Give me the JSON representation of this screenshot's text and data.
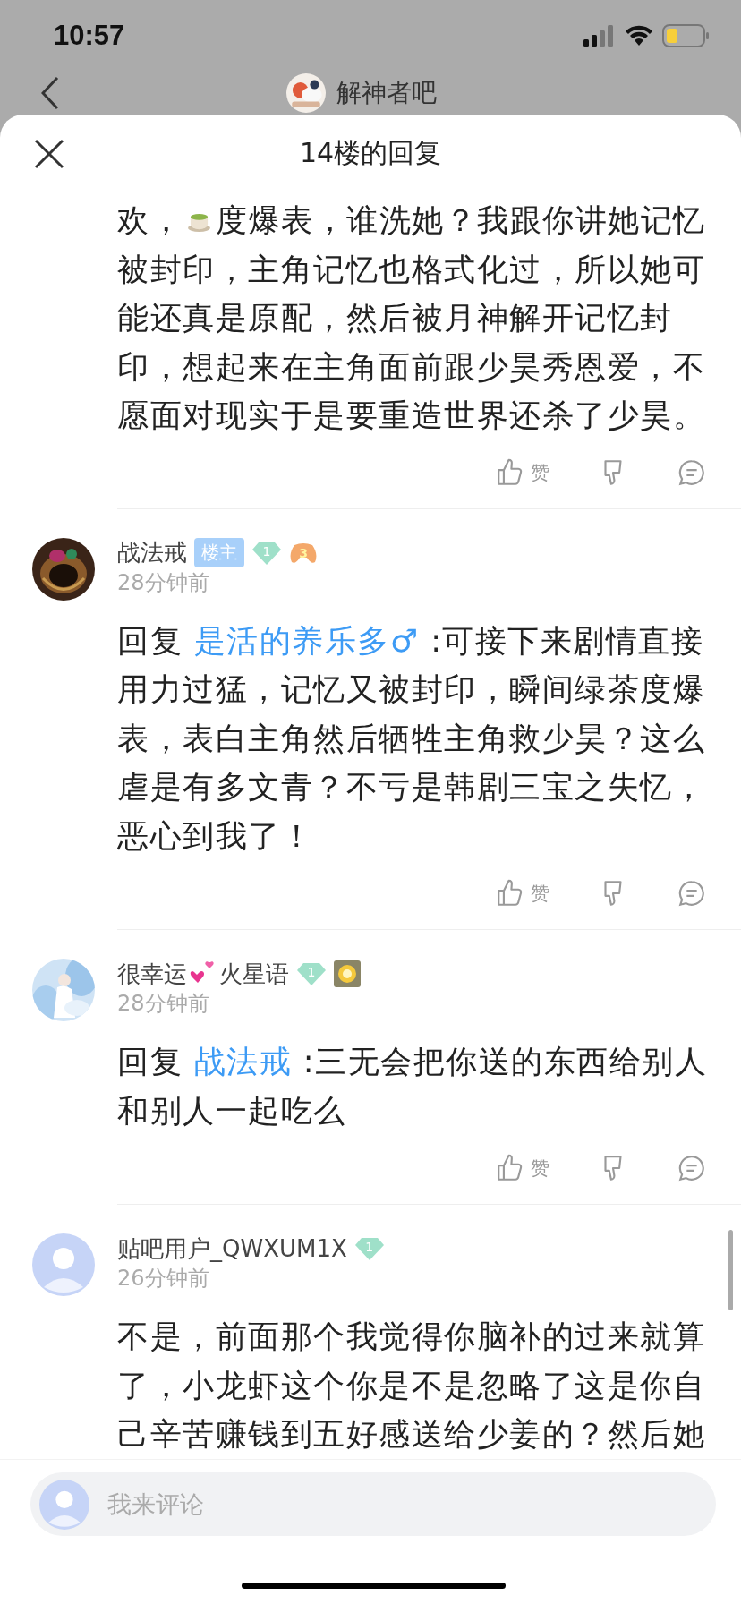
{
  "status_bar": {
    "time": "10:57"
  },
  "background_page": {
    "title": "解神者吧"
  },
  "sheet": {
    "title": "14楼的回复"
  },
  "comments": [
    {
      "kind": "partial",
      "text_before_emoji": "欢，",
      "text": "度爆表，谁洗她？我跟你讲她记忆被封印，主角记忆也格式化过，所以她可能还真是原配，然后被月神解开记忆封印，想起来在主角面前跟少昊秀恩爱，不愿面对现实于是要重造世界还杀了少昊。",
      "like_label": "赞"
    },
    {
      "kind": "full",
      "avatar": {
        "kind": "picture"
      },
      "name": "战法戒",
      "badges": [
        {
          "kind": "owner",
          "label": "楼主"
        },
        {
          "kind": "level",
          "label": "1"
        },
        {
          "kind": "game",
          "label": "3"
        }
      ],
      "time": "28分钟前",
      "reply_label": "回复",
      "reply_to": "是活的养乐多♂",
      "text": ":可接下来剧情直接用力过猛，记忆又被封印，瞬间绿茶度爆表，表白主角然后牺牲主角救少昊？这么虐是有多文青？不亏是韩剧三宝之失忆，恶心到我了！",
      "like_label": "赞"
    },
    {
      "kind": "full",
      "avatar": {
        "kind": "picture"
      },
      "name": "很幸运",
      "name_after_emoji": "火星语",
      "badges": [
        {
          "kind": "level",
          "label": "1"
        },
        {
          "kind": "medal"
        }
      ],
      "time": "28分钟前",
      "reply_label": "回复",
      "reply_to": "战法戒",
      "text": ":三无会把你送的东西给别人和别人一起吃么",
      "like_label": "赞"
    },
    {
      "kind": "full",
      "avatar": {
        "kind": "placeholder"
      },
      "name": "贴吧用户_QWXUM1X",
      "badges": [
        {
          "kind": "level",
          "label": "1"
        }
      ],
      "time": "26分钟前",
      "text": "不是，前面那个我觉得你脑补的过来就算了，小龙虾这个你是不是忽略了这是你自己辛苦赚钱到五好感送给少姜的？然后她"
    }
  ],
  "comment_box": {
    "placeholder": "我来评论"
  }
}
